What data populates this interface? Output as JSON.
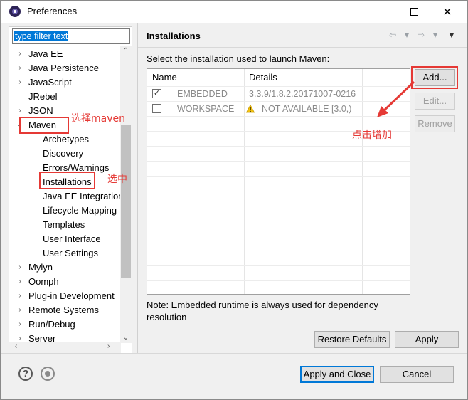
{
  "window": {
    "title": "Preferences",
    "maximize_glyph": "□",
    "close_glyph": "✕"
  },
  "filter": {
    "text": "type filter text"
  },
  "tree": {
    "items": [
      {
        "label": "Java EE",
        "arrow": "›"
      },
      {
        "label": "Java Persistence",
        "arrow": "›"
      },
      {
        "label": "JavaScript",
        "arrow": "›"
      },
      {
        "label": "JRebel",
        "arrow": ""
      },
      {
        "label": "JSON",
        "arrow": "›"
      },
      {
        "label": "Maven",
        "arrow": "⌄"
      },
      {
        "label": "Archetypes",
        "arrow": ""
      },
      {
        "label": "Discovery",
        "arrow": ""
      },
      {
        "label": "Errors/Warnings",
        "arrow": ""
      },
      {
        "label": "Installations",
        "arrow": ""
      },
      {
        "label": "Java EE Integration",
        "arrow": ""
      },
      {
        "label": "Lifecycle Mapping",
        "arrow": ""
      },
      {
        "label": "Templates",
        "arrow": ""
      },
      {
        "label": "User Interface",
        "arrow": ""
      },
      {
        "label": "User Settings",
        "arrow": ""
      },
      {
        "label": "Mylyn",
        "arrow": "›"
      },
      {
        "label": "Oomph",
        "arrow": "›"
      },
      {
        "label": "Plug-in Development",
        "arrow": "›"
      },
      {
        "label": "Remote Systems",
        "arrow": "›"
      },
      {
        "label": "Run/Debug",
        "arrow": "›"
      },
      {
        "label": "Server",
        "arrow": "›"
      }
    ]
  },
  "annotations": {
    "select_maven": "选择maven",
    "selected": "选中",
    "click_add": "点击增加"
  },
  "page": {
    "title": "Installations",
    "nav": {
      "back": "⇦",
      "forward": "⇨",
      "dropdown": "▾",
      "menu": "▼"
    },
    "select_label": "Select the installation used to launch Maven:",
    "columns": {
      "name": "Name",
      "details": "Details"
    },
    "rows": [
      {
        "checked": true,
        "check_glyph": "✓",
        "name": "EMBEDDED",
        "details": "3.3.9/1.8.2.20171007-0216",
        "warning": false
      },
      {
        "checked": false,
        "check_glyph": "",
        "name": "WORKSPACE",
        "details": "NOT AVAILABLE [3.0,)",
        "warning": true
      }
    ],
    "buttons": {
      "add": "Add...",
      "edit": "Edit...",
      "remove": "Remove"
    },
    "note": "Note: Embedded runtime is always used for dependency resolution",
    "restore_defaults": "Restore Defaults",
    "apply": "Apply"
  },
  "footer": {
    "help_glyph": "?",
    "apply_and_close": "Apply and Close",
    "cancel": "Cancel"
  },
  "colors": {
    "annotation": "#e53935",
    "selection": "#0078d7"
  }
}
